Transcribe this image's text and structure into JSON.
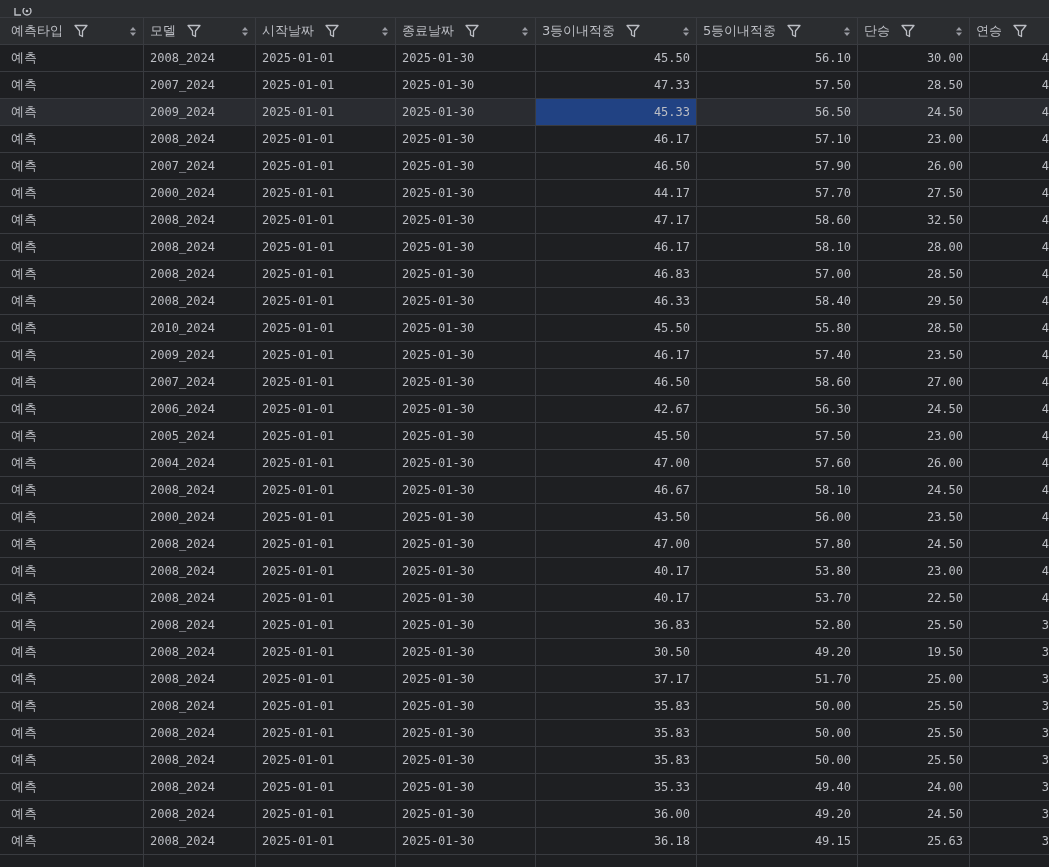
{
  "columns": [
    {
      "label": "예측타입",
      "kind": "text",
      "sort_icon": true
    },
    {
      "label": "모델",
      "kind": "text",
      "sort_icon": true
    },
    {
      "label": "시작날짜",
      "kind": "text",
      "sort_icon": true
    },
    {
      "label": "종료날짜",
      "kind": "text",
      "sort_icon": true
    },
    {
      "label": "3등이내적중",
      "kind": "number",
      "sort_icon": true
    },
    {
      "label": "5등이내적중",
      "kind": "number",
      "sort_icon": true
    },
    {
      "label": "단승",
      "kind": "number",
      "sort_icon": true
    },
    {
      "label": "연승",
      "kind": "number",
      "sort_icon": false
    }
  ],
  "rows": [
    {
      "selected": false,
      "cells": [
        {
          "text": "예측",
          "selected": false
        },
        {
          "text": "2008_2024",
          "selected": false
        },
        {
          "text": "2025-01-01",
          "selected": false
        },
        {
          "text": "2025-01-30",
          "selected": false
        },
        {
          "text": "45.50",
          "selected": false
        },
        {
          "text": "56.10",
          "selected": false
        },
        {
          "text": "30.00",
          "selected": false
        },
        {
          "text": "4",
          "selected": false
        }
      ]
    },
    {
      "selected": false,
      "cells": [
        {
          "text": "예측",
          "selected": false
        },
        {
          "text": "2007_2024",
          "selected": false
        },
        {
          "text": "2025-01-01",
          "selected": false
        },
        {
          "text": "2025-01-30",
          "selected": false
        },
        {
          "text": "47.33",
          "selected": false
        },
        {
          "text": "57.50",
          "selected": false
        },
        {
          "text": "28.50",
          "selected": false
        },
        {
          "text": "4",
          "selected": false
        }
      ]
    },
    {
      "selected": true,
      "cells": [
        {
          "text": "예측",
          "selected": false
        },
        {
          "text": "2009_2024",
          "selected": false
        },
        {
          "text": "2025-01-01",
          "selected": false
        },
        {
          "text": "2025-01-30",
          "selected": false
        },
        {
          "text": "45.33",
          "selected": true
        },
        {
          "text": "56.50",
          "selected": false
        },
        {
          "text": "24.50",
          "selected": false
        },
        {
          "text": "4",
          "selected": false
        }
      ]
    },
    {
      "selected": false,
      "cells": [
        {
          "text": "예측",
          "selected": false
        },
        {
          "text": "2008_2024",
          "selected": false
        },
        {
          "text": "2025-01-01",
          "selected": false
        },
        {
          "text": "2025-01-30",
          "selected": false
        },
        {
          "text": "46.17",
          "selected": false
        },
        {
          "text": "57.10",
          "selected": false
        },
        {
          "text": "23.00",
          "selected": false
        },
        {
          "text": "4",
          "selected": false
        }
      ]
    },
    {
      "selected": false,
      "cells": [
        {
          "text": "예측",
          "selected": false
        },
        {
          "text": "2007_2024",
          "selected": false
        },
        {
          "text": "2025-01-01",
          "selected": false
        },
        {
          "text": "2025-01-30",
          "selected": false
        },
        {
          "text": "46.50",
          "selected": false
        },
        {
          "text": "57.90",
          "selected": false
        },
        {
          "text": "26.00",
          "selected": false
        },
        {
          "text": "4",
          "selected": false
        }
      ]
    },
    {
      "selected": false,
      "cells": [
        {
          "text": "예측",
          "selected": false
        },
        {
          "text": "2000_2024",
          "selected": false
        },
        {
          "text": "2025-01-01",
          "selected": false
        },
        {
          "text": "2025-01-30",
          "selected": false
        },
        {
          "text": "44.17",
          "selected": false
        },
        {
          "text": "57.70",
          "selected": false
        },
        {
          "text": "27.50",
          "selected": false
        },
        {
          "text": "4",
          "selected": false
        }
      ]
    },
    {
      "selected": false,
      "cells": [
        {
          "text": "예측",
          "selected": false
        },
        {
          "text": "2008_2024",
          "selected": false
        },
        {
          "text": "2025-01-01",
          "selected": false
        },
        {
          "text": "2025-01-30",
          "selected": false
        },
        {
          "text": "47.17",
          "selected": false
        },
        {
          "text": "58.60",
          "selected": false
        },
        {
          "text": "32.50",
          "selected": false
        },
        {
          "text": "4",
          "selected": false
        }
      ]
    },
    {
      "selected": false,
      "cells": [
        {
          "text": "예측",
          "selected": false
        },
        {
          "text": "2008_2024",
          "selected": false
        },
        {
          "text": "2025-01-01",
          "selected": false
        },
        {
          "text": "2025-01-30",
          "selected": false
        },
        {
          "text": "46.17",
          "selected": false
        },
        {
          "text": "58.10",
          "selected": false
        },
        {
          "text": "28.00",
          "selected": false
        },
        {
          "text": "4",
          "selected": false
        }
      ]
    },
    {
      "selected": false,
      "cells": [
        {
          "text": "예측",
          "selected": false
        },
        {
          "text": "2008_2024",
          "selected": false
        },
        {
          "text": "2025-01-01",
          "selected": false
        },
        {
          "text": "2025-01-30",
          "selected": false
        },
        {
          "text": "46.83",
          "selected": false
        },
        {
          "text": "57.00",
          "selected": false
        },
        {
          "text": "28.50",
          "selected": false
        },
        {
          "text": "4",
          "selected": false
        }
      ]
    },
    {
      "selected": false,
      "cells": [
        {
          "text": "예측",
          "selected": false
        },
        {
          "text": "2008_2024",
          "selected": false
        },
        {
          "text": "2025-01-01",
          "selected": false
        },
        {
          "text": "2025-01-30",
          "selected": false
        },
        {
          "text": "46.33",
          "selected": false
        },
        {
          "text": "58.40",
          "selected": false
        },
        {
          "text": "29.50",
          "selected": false
        },
        {
          "text": "4",
          "selected": false
        }
      ]
    },
    {
      "selected": false,
      "cells": [
        {
          "text": "예측",
          "selected": false
        },
        {
          "text": "2010_2024",
          "selected": false
        },
        {
          "text": "2025-01-01",
          "selected": false
        },
        {
          "text": "2025-01-30",
          "selected": false
        },
        {
          "text": "45.50",
          "selected": false
        },
        {
          "text": "55.80",
          "selected": false
        },
        {
          "text": "28.50",
          "selected": false
        },
        {
          "text": "4",
          "selected": false
        }
      ]
    },
    {
      "selected": false,
      "cells": [
        {
          "text": "예측",
          "selected": false
        },
        {
          "text": "2009_2024",
          "selected": false
        },
        {
          "text": "2025-01-01",
          "selected": false
        },
        {
          "text": "2025-01-30",
          "selected": false
        },
        {
          "text": "46.17",
          "selected": false
        },
        {
          "text": "57.40",
          "selected": false
        },
        {
          "text": "23.50",
          "selected": false
        },
        {
          "text": "4",
          "selected": false
        }
      ]
    },
    {
      "selected": false,
      "cells": [
        {
          "text": "예측",
          "selected": false
        },
        {
          "text": "2007_2024",
          "selected": false
        },
        {
          "text": "2025-01-01",
          "selected": false
        },
        {
          "text": "2025-01-30",
          "selected": false
        },
        {
          "text": "46.50",
          "selected": false
        },
        {
          "text": "58.60",
          "selected": false
        },
        {
          "text": "27.00",
          "selected": false
        },
        {
          "text": "4",
          "selected": false
        }
      ]
    },
    {
      "selected": false,
      "cells": [
        {
          "text": "예측",
          "selected": false
        },
        {
          "text": "2006_2024",
          "selected": false
        },
        {
          "text": "2025-01-01",
          "selected": false
        },
        {
          "text": "2025-01-30",
          "selected": false
        },
        {
          "text": "42.67",
          "selected": false
        },
        {
          "text": "56.30",
          "selected": false
        },
        {
          "text": "24.50",
          "selected": false
        },
        {
          "text": "4",
          "selected": false
        }
      ]
    },
    {
      "selected": false,
      "cells": [
        {
          "text": "예측",
          "selected": false
        },
        {
          "text": "2005_2024",
          "selected": false
        },
        {
          "text": "2025-01-01",
          "selected": false
        },
        {
          "text": "2025-01-30",
          "selected": false
        },
        {
          "text": "45.50",
          "selected": false
        },
        {
          "text": "57.50",
          "selected": false
        },
        {
          "text": "23.00",
          "selected": false
        },
        {
          "text": "4",
          "selected": false
        }
      ]
    },
    {
      "selected": false,
      "cells": [
        {
          "text": "예측",
          "selected": false
        },
        {
          "text": "2004_2024",
          "selected": false
        },
        {
          "text": "2025-01-01",
          "selected": false
        },
        {
          "text": "2025-01-30",
          "selected": false
        },
        {
          "text": "47.00",
          "selected": false
        },
        {
          "text": "57.60",
          "selected": false
        },
        {
          "text": "26.00",
          "selected": false
        },
        {
          "text": "4",
          "selected": false
        }
      ]
    },
    {
      "selected": false,
      "cells": [
        {
          "text": "예측",
          "selected": false
        },
        {
          "text": "2008_2024",
          "selected": false
        },
        {
          "text": "2025-01-01",
          "selected": false
        },
        {
          "text": "2025-01-30",
          "selected": false
        },
        {
          "text": "46.67",
          "selected": false
        },
        {
          "text": "58.10",
          "selected": false
        },
        {
          "text": "24.50",
          "selected": false
        },
        {
          "text": "4",
          "selected": false
        }
      ]
    },
    {
      "selected": false,
      "cells": [
        {
          "text": "예측",
          "selected": false
        },
        {
          "text": "2000_2024",
          "selected": false
        },
        {
          "text": "2025-01-01",
          "selected": false
        },
        {
          "text": "2025-01-30",
          "selected": false
        },
        {
          "text": "43.50",
          "selected": false
        },
        {
          "text": "56.00",
          "selected": false
        },
        {
          "text": "23.50",
          "selected": false
        },
        {
          "text": "4",
          "selected": false
        }
      ]
    },
    {
      "selected": false,
      "cells": [
        {
          "text": "예측",
          "selected": false
        },
        {
          "text": "2008_2024",
          "selected": false
        },
        {
          "text": "2025-01-01",
          "selected": false
        },
        {
          "text": "2025-01-30",
          "selected": false
        },
        {
          "text": "47.00",
          "selected": false
        },
        {
          "text": "57.80",
          "selected": false
        },
        {
          "text": "24.50",
          "selected": false
        },
        {
          "text": "4",
          "selected": false
        }
      ]
    },
    {
      "selected": false,
      "cells": [
        {
          "text": "예측",
          "selected": false
        },
        {
          "text": "2008_2024",
          "selected": false
        },
        {
          "text": "2025-01-01",
          "selected": false
        },
        {
          "text": "2025-01-30",
          "selected": false
        },
        {
          "text": "40.17",
          "selected": false
        },
        {
          "text": "53.80",
          "selected": false
        },
        {
          "text": "23.00",
          "selected": false
        },
        {
          "text": "4",
          "selected": false
        }
      ]
    },
    {
      "selected": false,
      "cells": [
        {
          "text": "예측",
          "selected": false
        },
        {
          "text": "2008_2024",
          "selected": false
        },
        {
          "text": "2025-01-01",
          "selected": false
        },
        {
          "text": "2025-01-30",
          "selected": false
        },
        {
          "text": "40.17",
          "selected": false
        },
        {
          "text": "53.70",
          "selected": false
        },
        {
          "text": "22.50",
          "selected": false
        },
        {
          "text": "4",
          "selected": false
        }
      ]
    },
    {
      "selected": false,
      "cells": [
        {
          "text": "예측",
          "selected": false
        },
        {
          "text": "2008_2024",
          "selected": false
        },
        {
          "text": "2025-01-01",
          "selected": false
        },
        {
          "text": "2025-01-30",
          "selected": false
        },
        {
          "text": "36.83",
          "selected": false
        },
        {
          "text": "52.80",
          "selected": false
        },
        {
          "text": "25.50",
          "selected": false
        },
        {
          "text": "3",
          "selected": false
        }
      ]
    },
    {
      "selected": false,
      "cells": [
        {
          "text": "예측",
          "selected": false
        },
        {
          "text": "2008_2024",
          "selected": false
        },
        {
          "text": "2025-01-01",
          "selected": false
        },
        {
          "text": "2025-01-30",
          "selected": false
        },
        {
          "text": "30.50",
          "selected": false
        },
        {
          "text": "49.20",
          "selected": false
        },
        {
          "text": "19.50",
          "selected": false
        },
        {
          "text": "3",
          "selected": false
        }
      ]
    },
    {
      "selected": false,
      "cells": [
        {
          "text": "예측",
          "selected": false
        },
        {
          "text": "2008_2024",
          "selected": false
        },
        {
          "text": "2025-01-01",
          "selected": false
        },
        {
          "text": "2025-01-30",
          "selected": false
        },
        {
          "text": "37.17",
          "selected": false
        },
        {
          "text": "51.70",
          "selected": false
        },
        {
          "text": "25.00",
          "selected": false
        },
        {
          "text": "3",
          "selected": false
        }
      ]
    },
    {
      "selected": false,
      "cells": [
        {
          "text": "예측",
          "selected": false
        },
        {
          "text": "2008_2024",
          "selected": false
        },
        {
          "text": "2025-01-01",
          "selected": false
        },
        {
          "text": "2025-01-30",
          "selected": false
        },
        {
          "text": "35.83",
          "selected": false
        },
        {
          "text": "50.00",
          "selected": false
        },
        {
          "text": "25.50",
          "selected": false
        },
        {
          "text": "3",
          "selected": false
        }
      ]
    },
    {
      "selected": false,
      "cells": [
        {
          "text": "예측",
          "selected": false
        },
        {
          "text": "2008_2024",
          "selected": false
        },
        {
          "text": "2025-01-01",
          "selected": false
        },
        {
          "text": "2025-01-30",
          "selected": false
        },
        {
          "text": "35.83",
          "selected": false
        },
        {
          "text": "50.00",
          "selected": false
        },
        {
          "text": "25.50",
          "selected": false
        },
        {
          "text": "3",
          "selected": false
        }
      ]
    },
    {
      "selected": false,
      "cells": [
        {
          "text": "예측",
          "selected": false
        },
        {
          "text": "2008_2024",
          "selected": false
        },
        {
          "text": "2025-01-01",
          "selected": false
        },
        {
          "text": "2025-01-30",
          "selected": false
        },
        {
          "text": "35.83",
          "selected": false
        },
        {
          "text": "50.00",
          "selected": false
        },
        {
          "text": "25.50",
          "selected": false
        },
        {
          "text": "3",
          "selected": false
        }
      ]
    },
    {
      "selected": false,
      "cells": [
        {
          "text": "예측",
          "selected": false
        },
        {
          "text": "2008_2024",
          "selected": false
        },
        {
          "text": "2025-01-01",
          "selected": false
        },
        {
          "text": "2025-01-30",
          "selected": false
        },
        {
          "text": "35.33",
          "selected": false
        },
        {
          "text": "49.40",
          "selected": false
        },
        {
          "text": "24.00",
          "selected": false
        },
        {
          "text": "3",
          "selected": false
        }
      ]
    },
    {
      "selected": false,
      "cells": [
        {
          "text": "예측",
          "selected": false
        },
        {
          "text": "2008_2024",
          "selected": false
        },
        {
          "text": "2025-01-01",
          "selected": false
        },
        {
          "text": "2025-01-30",
          "selected": false
        },
        {
          "text": "36.00",
          "selected": false
        },
        {
          "text": "49.20",
          "selected": false
        },
        {
          "text": "24.50",
          "selected": false
        },
        {
          "text": "3",
          "selected": false
        }
      ]
    },
    {
      "selected": false,
      "cells": [
        {
          "text": "예측",
          "selected": false
        },
        {
          "text": "2008_2024",
          "selected": false
        },
        {
          "text": "2025-01-01",
          "selected": false
        },
        {
          "text": "2025-01-30",
          "selected": false
        },
        {
          "text": "36.18",
          "selected": false
        },
        {
          "text": "49.15",
          "selected": false
        },
        {
          "text": "25.63",
          "selected": false
        },
        {
          "text": "3",
          "selected": false
        }
      ]
    }
  ]
}
